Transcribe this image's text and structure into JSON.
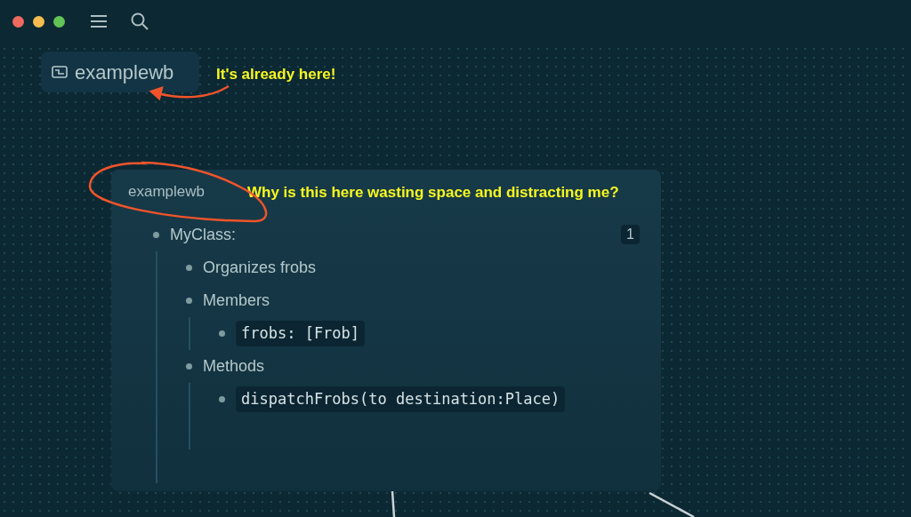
{
  "workspace": {
    "label": "examplewb"
  },
  "card": {
    "title": "examplewb",
    "badge": "1",
    "outline": [
      {
        "kind": "text",
        "text": "MyClass:",
        "children": [
          {
            "kind": "text",
            "text": "Organizes frobs"
          },
          {
            "kind": "text",
            "text": "Members",
            "children": [
              {
                "kind": "code",
                "text": "frobs: [Frob]"
              }
            ]
          },
          {
            "kind": "text",
            "text": "Methods",
            "children": [
              {
                "kind": "code",
                "text": "dispatchFrobs(to destination:Place)"
              }
            ]
          }
        ]
      }
    ]
  },
  "annotations": [
    {
      "text": "It's already here!"
    },
    {
      "text": "Why is this here wasting space and distracting me?"
    }
  ]
}
